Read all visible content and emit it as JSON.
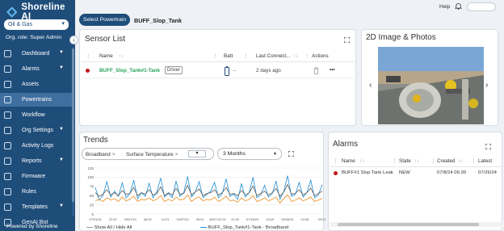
{
  "app": {
    "title": "Shoreline AI"
  },
  "sidebar": {
    "industry": "Oil & Gas",
    "org_role": "Org. role: Super Admin",
    "items": [
      {
        "label": "Dashboard",
        "icon": "dashboard-icon",
        "caret": true
      },
      {
        "label": "Alarms",
        "icon": "bell-icon",
        "caret": true
      },
      {
        "label": "Assets",
        "icon": "assets-icon",
        "caret": false
      },
      {
        "label": "Powertrains",
        "icon": "powertrain-icon",
        "caret": false,
        "active": true
      },
      {
        "label": "Workflow",
        "icon": "workflow-icon",
        "caret": false
      },
      {
        "label": "Org Settings",
        "icon": "settings-icon",
        "caret": true
      },
      {
        "label": "Activity Logs",
        "icon": "log-icon",
        "caret": false
      },
      {
        "label": "Reports",
        "icon": "report-icon",
        "caret": true
      },
      {
        "label": "Firmware",
        "icon": "firmware-icon",
        "caret": false
      },
      {
        "label": "Rules",
        "icon": "rules-icon",
        "caret": false
      },
      {
        "label": "Templates",
        "icon": "template-icon",
        "caret": true
      },
      {
        "label": "GenAI Bot",
        "icon": "bot-icon",
        "caret": false
      }
    ],
    "powered_by": "Powered by Shoreline"
  },
  "topbar": {
    "help": "Help"
  },
  "breadcrumb": {
    "select_button": "Select Powertrain",
    "powertrain_name": "BUFF_Slop_Tank"
  },
  "sensor_list": {
    "title": "Sensor List",
    "columns": {
      "name": "Name",
      "batt": "Batt",
      "last_connect": "Last Connect...",
      "actions": "Actions"
    },
    "rows": [
      {
        "name": "BUFF_Slop_Tank#1-Tank",
        "tag": "Driver",
        "batt": "--",
        "last_connect": "2 days ago",
        "more": "•••"
      }
    ]
  },
  "photos": {
    "title": "2D Image & Photos"
  },
  "trends": {
    "title": "Trends",
    "filters": [
      "Broadband",
      "Surface Temperature"
    ],
    "range": "3 Months",
    "legend": {
      "toggle": "Show All / Hide All",
      "series_label": "BUFF_Slop_Tank#1-Tank - Broadband"
    }
  },
  "chart_data": {
    "type": "line",
    "ylim": [
      0,
      125
    ],
    "yticks": [
      0,
      25,
      50,
      75,
      100,
      125
    ],
    "xticks": [
      "07/01/24",
      "22:42",
      "29/07/24",
      "06:00",
      "14:21",
      "20/07/24",
      "06:01",
      "40/07/12:24",
      "12:40",
      "07/18/24",
      "13:00",
      "09/06/24",
      "14:08",
      "09:20"
    ],
    "series": [
      {
        "name": "",
        "color": "#1e8fd4",
        "values": [
          72,
          38,
          50,
          88,
          46,
          62,
          48,
          85,
          44,
          56,
          92,
          42,
          58,
          48,
          84,
          44,
          60,
          98,
          46,
          56,
          44,
          90,
          48,
          58,
          102,
          46,
          60,
          88,
          44,
          54,
          62,
          86,
          44,
          56,
          96,
          48,
          54,
          40,
          82,
          46,
          58,
          100,
          44,
          52,
          78,
          46,
          56,
          90,
          40,
          62,
          104,
          48,
          54,
          86,
          46,
          58,
          92,
          44,
          52,
          80
        ]
      },
      {
        "name": "",
        "color": "#5a5a5a",
        "values": [
          58,
          48,
          54,
          66,
          52,
          58,
          50,
          64,
          54,
          56,
          72,
          50,
          58,
          54,
          66,
          52,
          56,
          74,
          50,
          58,
          52,
          70,
          54,
          56,
          78,
          52,
          60,
          68,
          50,
          56,
          58,
          66,
          52,
          58,
          72,
          54,
          56,
          50,
          64,
          52,
          58,
          76,
          50,
          56,
          62,
          52,
          58,
          70,
          48,
          60,
          80,
          54,
          56,
          66,
          52,
          58,
          70,
          50,
          56,
          62
        ]
      },
      {
        "name": "",
        "color": "#e88a1a",
        "values": [
          36,
          40,
          34,
          44,
          38,
          42,
          34,
          46,
          36,
          40,
          48,
          34,
          40,
          38,
          44,
          36,
          40,
          50,
          34,
          40,
          36,
          46,
          38,
          40,
          52,
          34,
          42,
          46,
          36,
          40,
          38,
          46,
          34,
          40,
          48,
          36,
          38,
          32,
          44,
          36,
          40,
          50,
          34,
          38,
          44,
          36,
          40,
          46,
          30,
          42,
          52,
          34,
          38,
          44,
          36,
          40,
          46,
          34,
          38,
          42
        ]
      }
    ]
  },
  "alarms": {
    "title": "Alarms",
    "columns": {
      "name": "Name",
      "state": "State",
      "created": "Created",
      "latest": "Latest"
    },
    "rows": [
      {
        "name": "BUFF#1 Slop Tank Leak",
        "state": "NEW",
        "created": "07/8/24 06:30",
        "latest": "07/26/24"
      }
    ]
  }
}
